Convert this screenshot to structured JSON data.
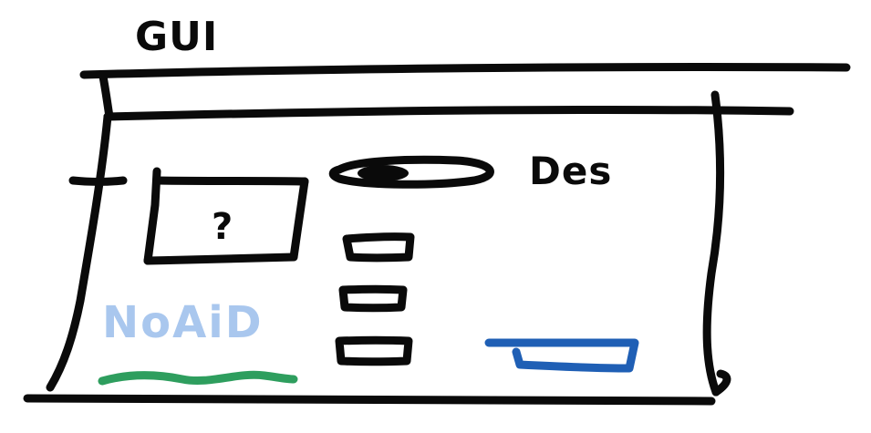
{
  "window": {
    "title": "GUI"
  },
  "image_placeholder": {
    "label": "?"
  },
  "toggle": {
    "label": "Des"
  },
  "footer": {
    "link_text": "NoAiD"
  },
  "colors": {
    "ink": "#0a0a0a",
    "link_text": "#a9c7ee",
    "underline": "#2e9e5e",
    "accent_bar": "#1f5fb5"
  }
}
